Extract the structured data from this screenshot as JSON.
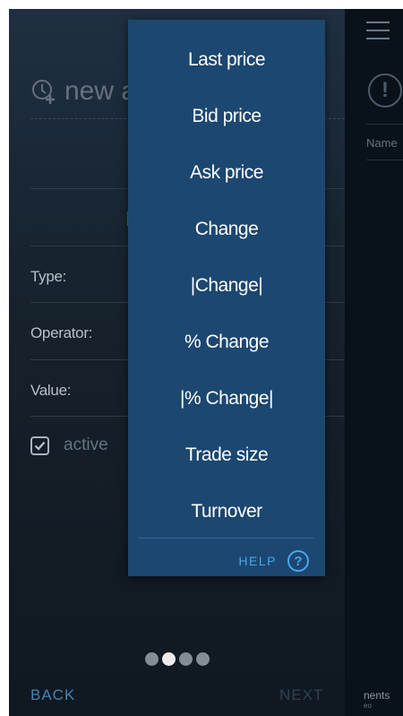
{
  "form": {
    "title": "new a",
    "type_label": "Type:",
    "operator_label": "Operator:",
    "value_label": "Value:",
    "active_label": "active",
    "active_checked": true
  },
  "pager": {
    "count": 4,
    "active_index": 1
  },
  "footer": {
    "back": "BACK",
    "next": "NEXT"
  },
  "right_panel": {
    "column_header": "Name",
    "bottom_text": "nents",
    "bottom_subtext": "eo"
  },
  "dropdown": {
    "items": [
      "Last price",
      "Bid price",
      "Ask price",
      "Change",
      "|Change|",
      "% Change",
      "|% Change|",
      "Trade size",
      "Turnover"
    ],
    "help_label": "HELP",
    "help_icon": "?"
  },
  "colors": {
    "menu_bg": "#1c4770",
    "accent_blue": "#4aa6e8",
    "back_blue": "#4a8ec5"
  }
}
